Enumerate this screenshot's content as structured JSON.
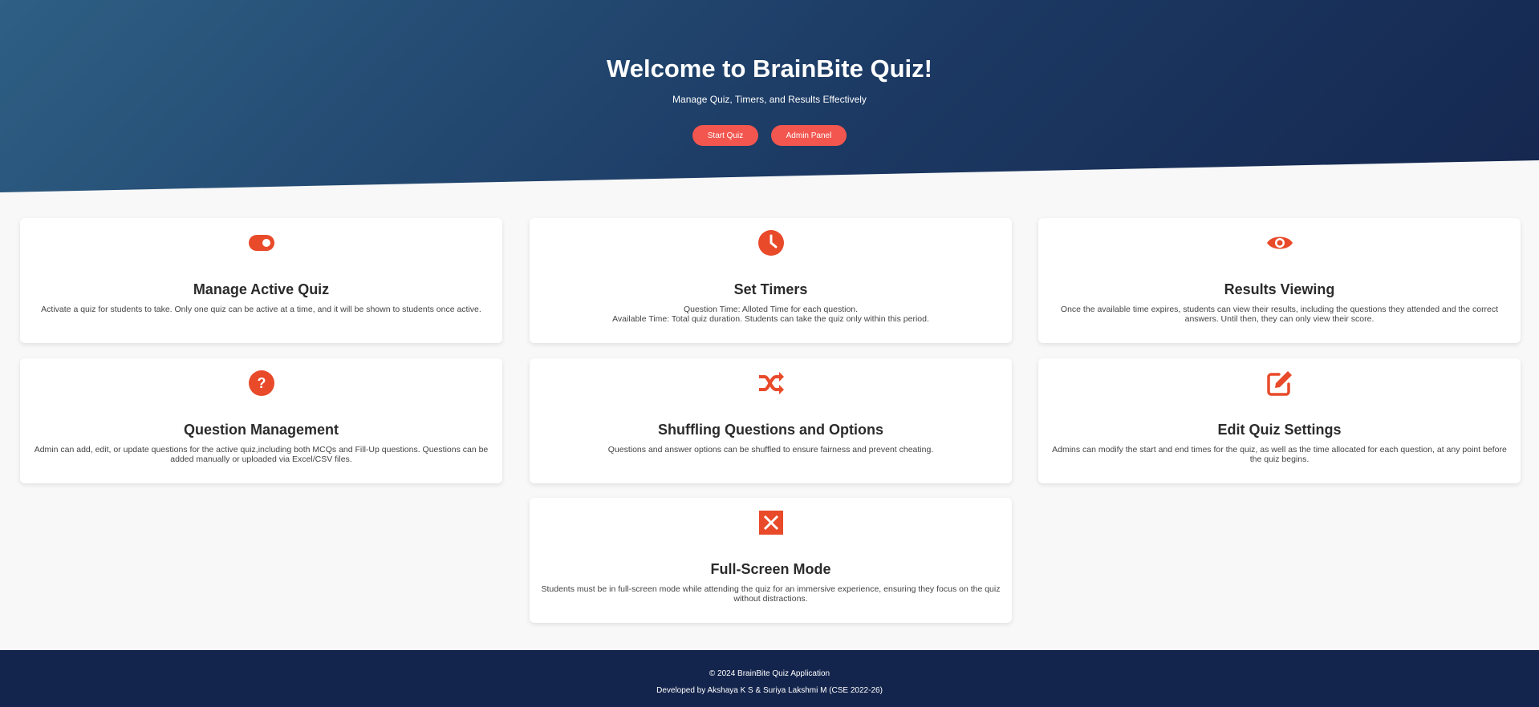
{
  "hero": {
    "title": "Welcome to BrainBite Quiz!",
    "subtitle": "Manage Quiz, Timers, and Results Effectively",
    "start_label": "Start Quiz",
    "admin_label": "Admin Panel",
    "accent": "#f2564f"
  },
  "features": [
    {
      "icon": "toggle-on-icon",
      "title": "Manage Active Quiz",
      "desc1": "Activate a quiz for students to take. Only one quiz can be active at a time, and it will be shown to students once active.",
      "desc2": ""
    },
    {
      "icon": "clock-icon",
      "title": "Set Timers",
      "desc1": "Question Time: Alloted Time for each question.",
      "desc2": "Available Time: Total quiz duration. Students can take the quiz only within this period."
    },
    {
      "icon": "eye-icon",
      "title": "Results Viewing",
      "desc1": "Once the available time expires, students can view their results, including the questions they attended and the correct answers. Until then, they can only view their score.",
      "desc2": ""
    },
    {
      "icon": "question-circle-icon",
      "title": "Question Management",
      "desc1": "Admin can add, edit, or update questions for the active quiz,including both MCQs and Fill-Up questions. Questions can be added manually or uploaded via Excel/CSV files.",
      "desc2": ""
    },
    {
      "icon": "shuffle-icon",
      "title": "Shuffling Questions and Options",
      "desc1": "Questions and answer options can be shuffled to ensure fairness and prevent cheating.",
      "desc2": ""
    },
    {
      "icon": "edit-icon",
      "title": "Edit Quiz Settings",
      "desc1": "Admins can modify the start and end times for the quiz, as well as the time allocated for each question, at any point before the quiz begins.",
      "desc2": ""
    },
    {
      "icon": "expand-icon",
      "title": "Full-Screen Mode",
      "desc1": "Students must be in full-screen mode while attending the quiz for an immersive experience, ensuring they focus on the quiz without distractions.",
      "desc2": ""
    }
  ],
  "footer": {
    "copyright": "© 2024 BrainBite Quiz Application",
    "developers": "Developed by Akshaya K S & Suriya Lakshmi M (CSE 2022-26)"
  },
  "colors": {
    "icon": "#e84a2a",
    "footer_bg": "#14254d",
    "hero_start": "#2e5f84",
    "hero_end": "#15274f"
  }
}
